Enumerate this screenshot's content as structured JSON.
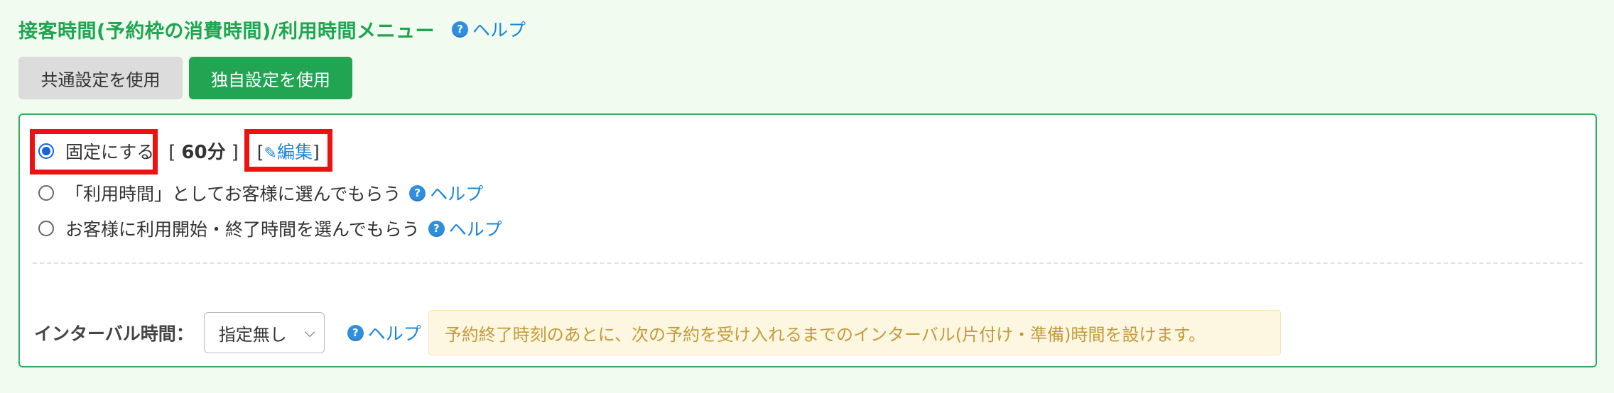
{
  "header": {
    "title": "接客時間(予約枠の消費時間)/利用時間メニュー",
    "help_label": "ヘルプ"
  },
  "buttons": {
    "common_label": "共通設定を使用",
    "custom_label": "独自設定を使用"
  },
  "options": [
    {
      "label": "固定にする",
      "checked": true
    },
    {
      "label": "「利用時間」としてお客様に選んでもらう",
      "checked": false,
      "help_label": "ヘルプ"
    },
    {
      "label": "お客様に利用開始・終了時間を選んでもらう",
      "checked": false,
      "help_label": "ヘルプ"
    }
  ],
  "fixed": {
    "bracket_open": "[",
    "duration": "60分",
    "bracket_close": "]",
    "edit_open": "[",
    "edit_label": "編集",
    "edit_close": "]"
  },
  "interval": {
    "label": "インターバル時間：",
    "selected": "指定無し",
    "help_label": "ヘルプ",
    "note": "予約終了時刻のあとに、次の予約を受け入れるまでのインターバル(片付け・準備)時間を設けます。"
  },
  "colors": {
    "accent": "#21a553",
    "link": "#1a86d9",
    "highlight": "#ee1111",
    "note_text": "#c39a3a"
  },
  "icons": {
    "help": "question-circle-icon",
    "edit": "pencil-icon",
    "dropdown": "chevron-down-icon"
  }
}
